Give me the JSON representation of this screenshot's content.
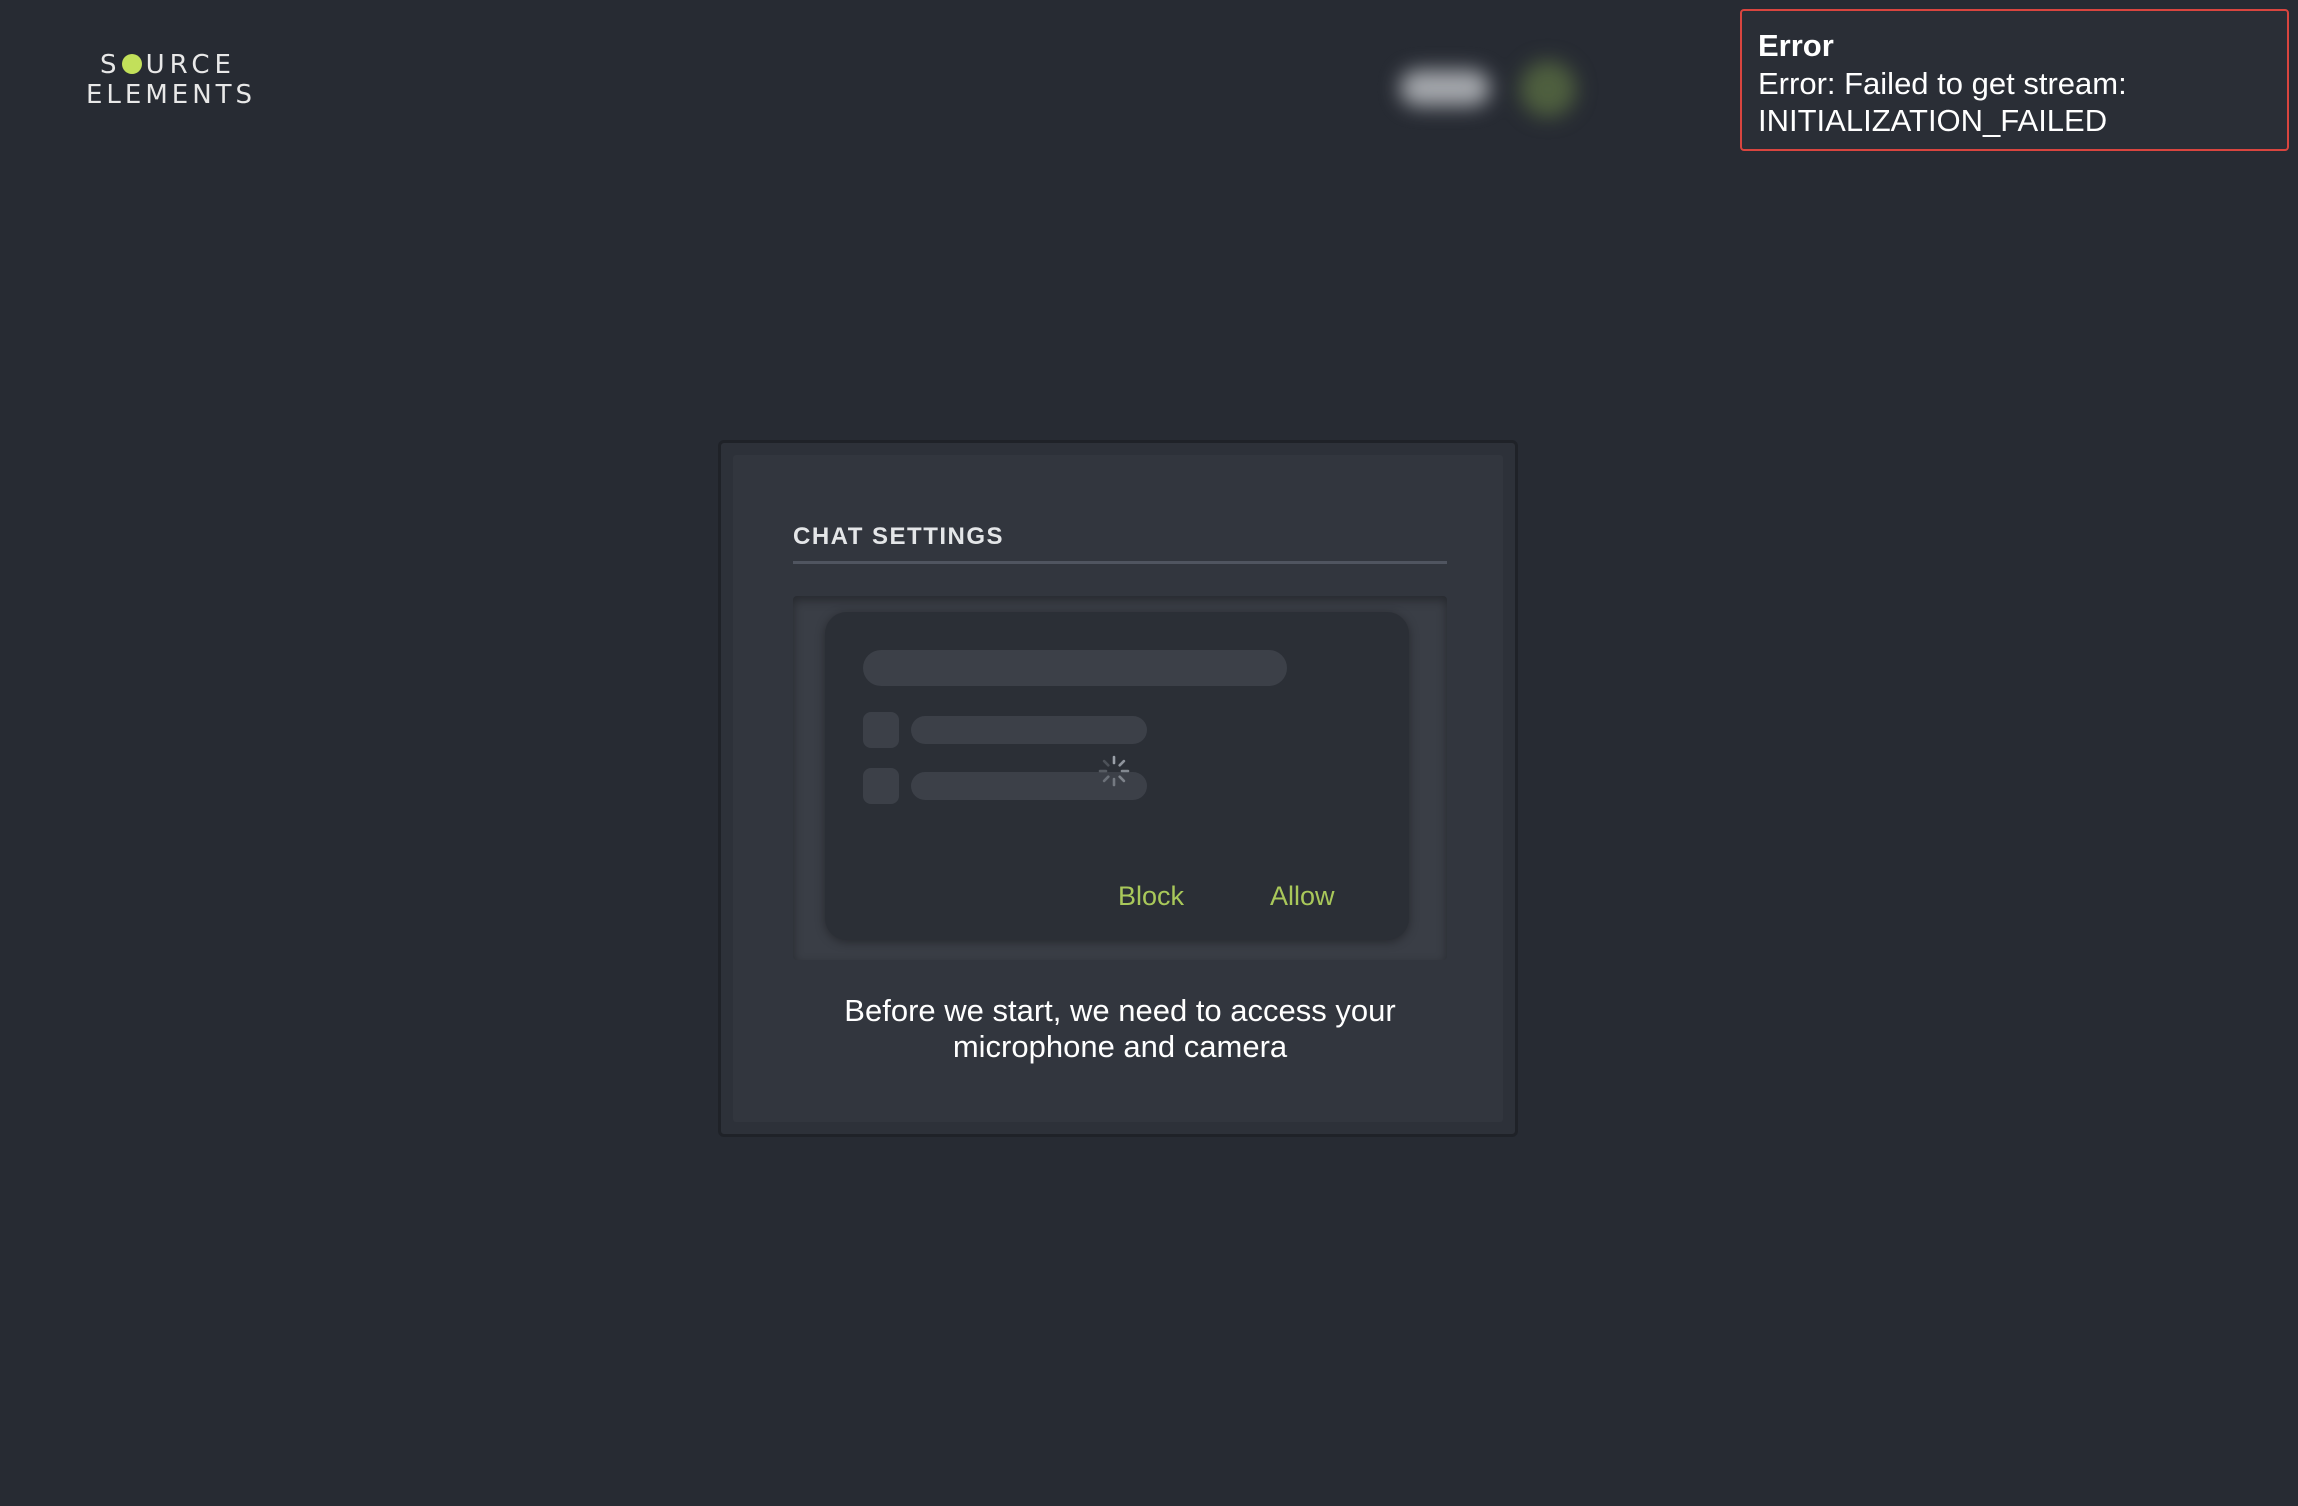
{
  "logo": {
    "line1_pre": "S",
    "line1_post": "URCE",
    "line2": "ELEMENTS",
    "accent_color": "#c2e05a"
  },
  "error_toast": {
    "title": "Error",
    "message": "Error: Failed to get stream: INITIALIZATION_FAILED",
    "border_color": "#d9453f"
  },
  "modal": {
    "title": "CHAT SETTINGS",
    "prompt": {
      "block_label": "Block",
      "allow_label": "Allow",
      "button_color": "#a9c85a",
      "spinner_icon": "loading-spinner-icon"
    },
    "caption": "Before we start, we need to access your microphone and camera"
  }
}
